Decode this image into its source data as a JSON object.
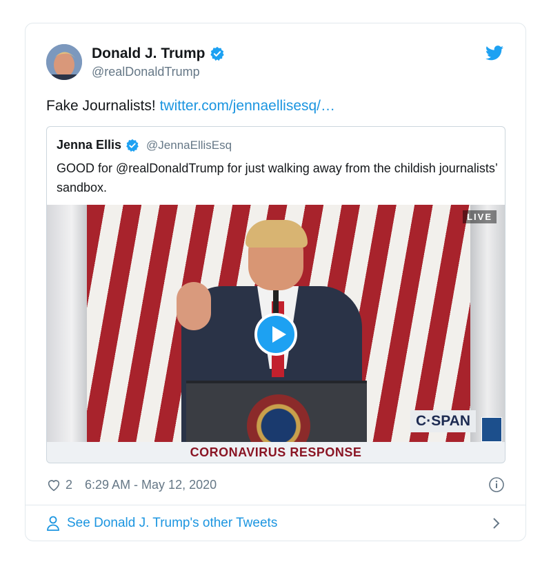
{
  "tweet": {
    "author_name": "Donald J. Trump",
    "author_handle": "@realDonaldTrump",
    "text": "Fake Journalists!",
    "link": "twitter.com/jennaellisesq/…",
    "likes": "2",
    "timestamp": "6:29 AM - May 12, 2020"
  },
  "quoted": {
    "author_name": "Jenna Ellis",
    "author_handle": "@JennaEllisEsq",
    "text": "GOOD for @realDonaldTrump for just walking away from the childish journalists’ sandbox.",
    "video": {
      "live_badge": "LIVE",
      "network": "C·SPAN",
      "banner": "CORONAVIRUS RESPONSE"
    }
  },
  "footer": {
    "see_more": "See Donald J. Trump's other Tweets"
  },
  "colors": {
    "accent": "#1da1f2",
    "link": "#1b95e0",
    "muted": "#657786",
    "border": "#e1e8ed"
  },
  "icons": [
    "verified-badge-icon",
    "twitter-bird-icon",
    "play-icon",
    "heart-icon",
    "info-icon",
    "person-icon",
    "chevron-right-icon"
  ]
}
